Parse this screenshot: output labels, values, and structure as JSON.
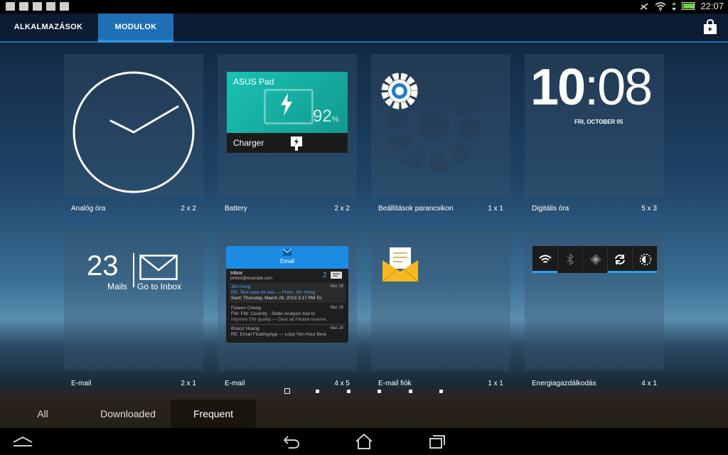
{
  "status_bar": {
    "time": "22:07",
    "notification_icons": [
      "file-icon",
      "image-icon",
      "mail-icon",
      "briefcase-icon",
      "camera-icon"
    ],
    "system_icons": [
      "airplane-off-icon",
      "wifi-icon",
      "data-arrows-icon",
      "battery-icon"
    ]
  },
  "top_tabs": [
    {
      "label": "ALKALMAZÁSOK",
      "active": false
    },
    {
      "label": "MODULOK",
      "active": true
    }
  ],
  "store_icon": "shopping-bag-icon",
  "widgets": [
    {
      "name": "Analóg óra",
      "size": "2 x 2"
    },
    {
      "name": "Battery",
      "size": "2 x 2"
    },
    {
      "name": "Beállítások parancsikon",
      "size": "1 x 1"
    },
    {
      "name": "Digitális óra",
      "size": "5 x 3"
    },
    {
      "name": "E-mail",
      "size": "2 x 1"
    },
    {
      "name": "E-mail",
      "size": "4 x 5"
    },
    {
      "name": "E-mail fiók",
      "size": "1 x 1"
    },
    {
      "name": "Energiagazdálkodás",
      "size": "4 x 1"
    }
  ],
  "battery_widget": {
    "device": "ASUS Pad",
    "percent": "92",
    "percent_sign": "%",
    "charger_label": "Charger"
  },
  "digital_clock": {
    "hours": "10",
    "minutes": "08",
    "date": "FRI, OCTOBER 05"
  },
  "email_small": {
    "count": "23",
    "mails_label": "Mails",
    "inbox_label": "Go to Inbox"
  },
  "email_large": {
    "header": "Email",
    "folder": "Inbox",
    "account": "jimtest@example.com",
    "unread": "2",
    "messages": [
      {
        "from": "Jim Hong",
        "date": "Mar 28",
        "subject": "RE: Test case for eas — From: Jim Hong",
        "preview": "Sent: Thursday, March 28, 2013 3:17 PM To:"
      },
      {
        "from": "Feiwen Cheng",
        "date": "Mar 28",
        "subject": "FW: FW: Coverity - Static Analysis tool to",
        "preview": "improve SW quality — Dear all Please reserve"
      },
      {
        "from": "Brian2 Huang",
        "date": "Mar 28",
        "subject": "RE: Email FloatingApp — Loop Yen-Hour Best",
        "preview": ""
      }
    ]
  },
  "power_toggles": [
    "wifi-icon",
    "bluetooth-icon",
    "gps-icon",
    "sync-icon",
    "brightness-icon"
  ],
  "page_indicator": {
    "pages": 6,
    "current": 1
  },
  "bottom_tabs": [
    {
      "label": "All",
      "active": false
    },
    {
      "label": "Downloaded",
      "active": false
    },
    {
      "label": "Frequent",
      "active": true
    }
  ],
  "nav_buttons": [
    "menu-icon",
    "back-icon",
    "home-icon",
    "recent-apps-icon"
  ],
  "colors": {
    "accent": "#1e6fb5",
    "battery_teal": "#1fb3a5",
    "email_blue": "#1c8ce3",
    "mail_yellow": "#f5b820"
  }
}
